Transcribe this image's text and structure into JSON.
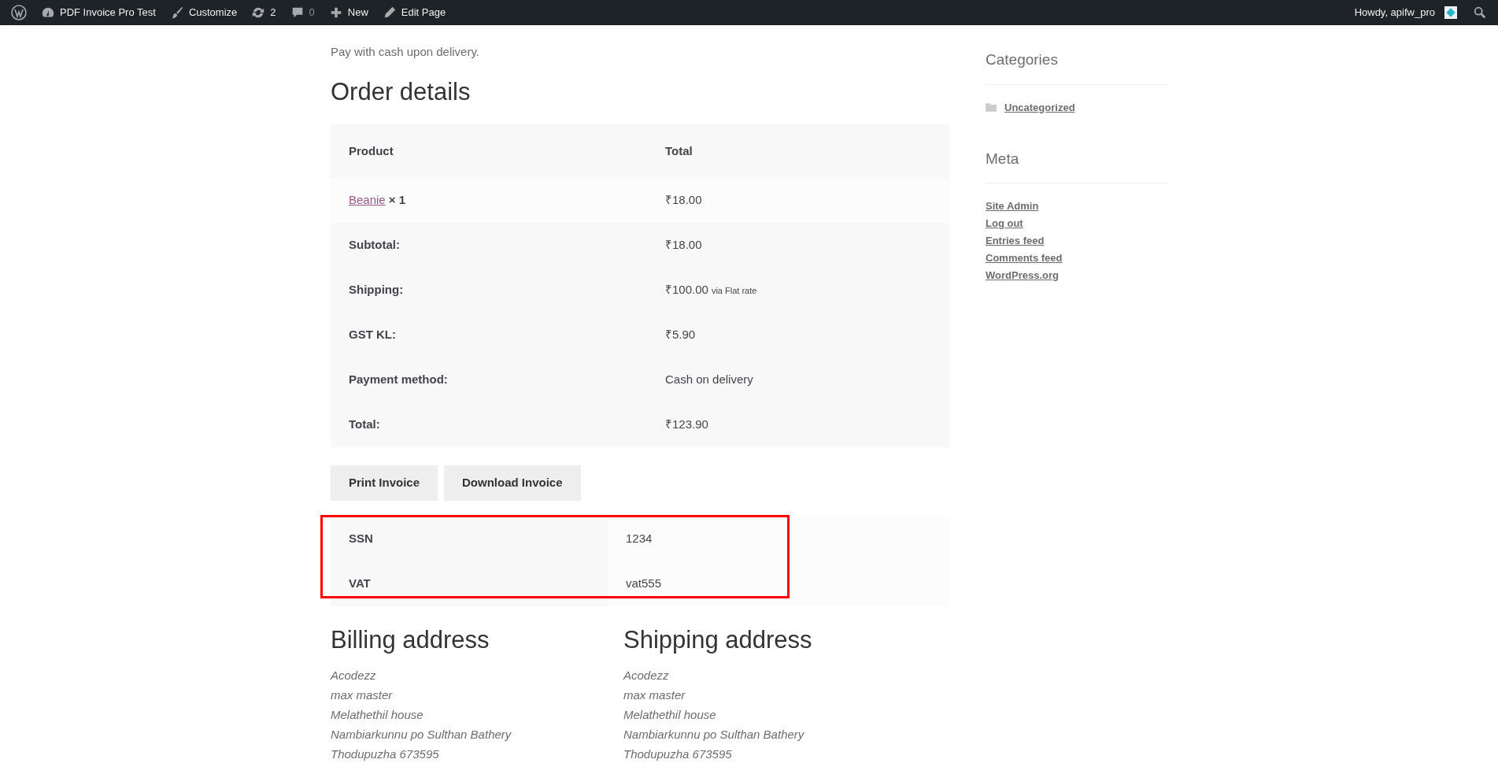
{
  "admin_bar": {
    "items": [
      {
        "label": "PDF Invoice Pro Test"
      },
      {
        "label": "Customize"
      },
      {
        "label": "2"
      },
      {
        "label": "0"
      },
      {
        "label": "New"
      },
      {
        "label": "Edit Page"
      }
    ],
    "greeting": "Howdy, apifw_pro"
  },
  "payment_note": "Pay with cash upon delivery.",
  "order_details": {
    "title": "Order details",
    "columns": [
      "Product",
      "Total"
    ],
    "item": {
      "name": "Beanie",
      "qty": "× 1",
      "total": "₹18.00"
    },
    "totals": [
      {
        "label": "Subtotal:",
        "value": "₹18.00"
      },
      {
        "label": "Shipping:",
        "value": "₹100.00",
        "note": "via Flat rate"
      },
      {
        "label": "GST KL:",
        "value": "₹5.90"
      },
      {
        "label": "Payment method:",
        "value": "Cash on delivery"
      },
      {
        "label": "Total:",
        "value": "₹123.90"
      }
    ]
  },
  "buttons": [
    "Print Invoice",
    "Download Invoice"
  ],
  "extra_fields": [
    {
      "label": "SSN",
      "value": "1234"
    },
    {
      "label": "VAT",
      "value": "vat555"
    }
  ],
  "addresses": [
    {
      "title": "Billing address",
      "lines": [
        "Acodezz",
        "max master",
        "Melathethil house",
        "Nambiarkunnu po Sulthan Bathery",
        "Thodupuzha 673595"
      ]
    },
    {
      "title": "Shipping address",
      "lines": [
        "Acodezz",
        "max master",
        "Melathethil house",
        "Nambiarkunnu po Sulthan Bathery",
        "Thodupuzha 673595"
      ]
    }
  ],
  "sidebar": [
    {
      "title": "Categories",
      "kind": "categories",
      "links": [
        "Uncategorized"
      ]
    },
    {
      "title": "Meta",
      "kind": "links",
      "links": [
        "Site Admin",
        "Log out",
        "Entries feed",
        "Comments feed",
        "WordPress.org"
      ]
    }
  ]
}
